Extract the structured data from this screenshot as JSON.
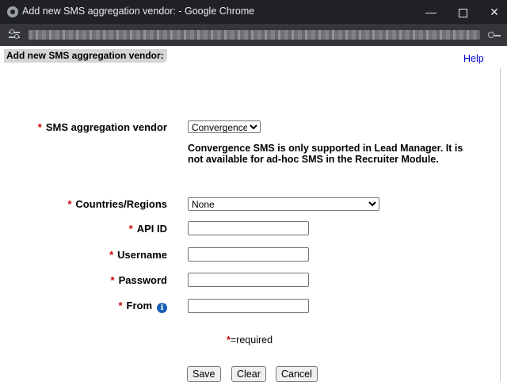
{
  "window": {
    "title": "Add new SMS aggregation vendor: - Google Chrome",
    "min_glyph": "—",
    "close_glyph": "✕"
  },
  "page": {
    "tooltip": "Add new SMS aggregation vendor:",
    "help_label": "Help"
  },
  "form": {
    "vendor": {
      "label": "SMS aggregation vendor",
      "value": "Convergence"
    },
    "note": "Convergence SMS is only supported in Lead Manager. It is not available for ad-hoc SMS in the Recruiter Module.",
    "countries": {
      "label": "Countries/Regions",
      "value": "None"
    },
    "api_id": {
      "label": "API ID",
      "value": ""
    },
    "username": {
      "label": "Username",
      "value": ""
    },
    "password": {
      "label": "Password",
      "value": ""
    },
    "from": {
      "label": "From",
      "value": ""
    },
    "required_star": "*",
    "required_note": "=required"
  },
  "buttons": {
    "save": "Save",
    "clear": "Clear",
    "cancel": "Cancel"
  },
  "colors": {
    "required": "#cc0000",
    "link": "#0000cc",
    "info": "#1a5fb4"
  }
}
